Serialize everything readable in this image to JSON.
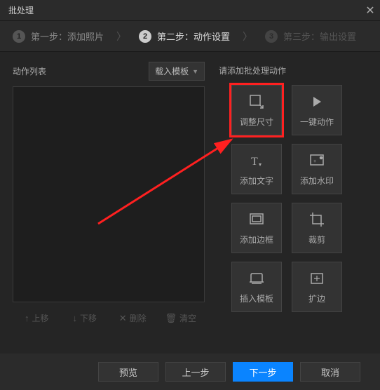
{
  "titlebar": {
    "title": "批处理"
  },
  "steps": {
    "s1": {
      "num": "1",
      "label": "第一步：添加照片"
    },
    "s2": {
      "num": "2",
      "label": "第二步：动作设置"
    },
    "s3": {
      "num": "3",
      "label": "第三步：输出设置"
    }
  },
  "left": {
    "title": "动作列表",
    "load_template": "载入模板",
    "btn_up": "上移",
    "btn_down": "下移",
    "btn_delete": "删除",
    "btn_clear": "清空"
  },
  "right": {
    "title": "请添加批处理动作",
    "actions": {
      "resize": "调整尺寸",
      "onekey": "一键动作",
      "text": "添加文字",
      "watermark": "添加水印",
      "border": "添加边框",
      "crop": "裁剪",
      "template": "插入模板",
      "expand": "扩边"
    }
  },
  "footer": {
    "preview": "预览",
    "prev": "上一步",
    "next": "下一步",
    "cancel": "取消"
  }
}
